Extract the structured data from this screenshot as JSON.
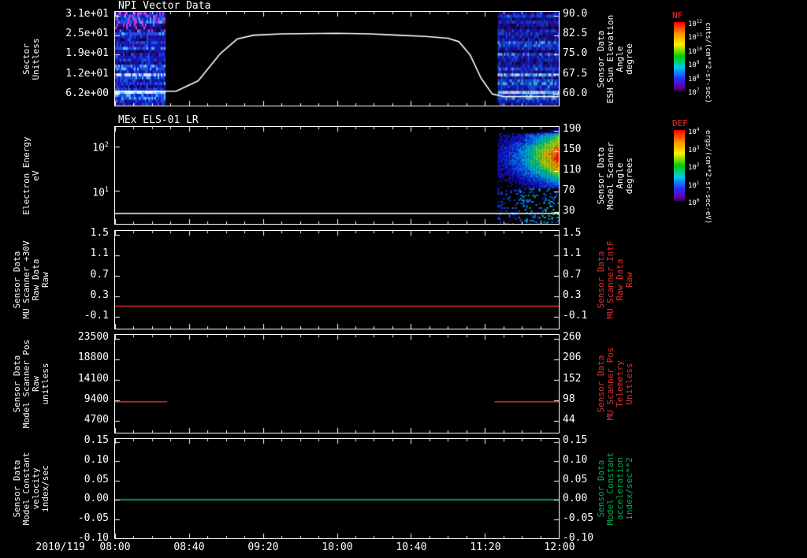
{
  "date_label": "2010/119",
  "colors": {
    "background": "#000000",
    "axis": "#ffffff",
    "red_series": "#e03030",
    "green_series": "#00b050"
  },
  "xaxis": {
    "ticks": [
      "08:00",
      "08:40",
      "09:20",
      "10:00",
      "10:40",
      "11:20",
      "12:00"
    ],
    "start_hour": 8,
    "end_hour": 12
  },
  "chart_data": [
    {
      "type": "heatmap",
      "name": "npi-vector-data",
      "title": "NPI Vector Data",
      "left_axis": {
        "label_lines": [
          "Sector",
          "Unitless"
        ],
        "ticks": [
          "3.1e+01",
          "2.5e+01",
          "1.9e+01",
          "1.2e+01",
          "6.2e+00"
        ]
      },
      "right_axis": {
        "label_lines": [
          "Sensor Data",
          "ESH Sun Elevation",
          "Angle",
          "degree"
        ],
        "label_color": "#ffffff",
        "ticks": [
          "90.0",
          "82.5",
          "75.0",
          "67.5",
          "60.0"
        ],
        "tick_values": [
          90.0,
          82.5,
          75.0,
          67.5,
          60.0
        ]
      },
      "heatmap_regions": [
        {
          "t0": 8.0,
          "t1": 8.45
        },
        {
          "t0": 11.45,
          "t1": 12.0
        }
      ],
      "line_series": {
        "name": "ESH Sun Elevation Angle",
        "color": "#ffffff",
        "axis": "right",
        "points": [
          [
            8.0,
            61
          ],
          [
            8.55,
            61
          ],
          [
            8.75,
            65
          ],
          [
            8.95,
            75.5
          ],
          [
            9.1,
            81
          ],
          [
            9.25,
            82.5
          ],
          [
            9.5,
            83
          ],
          [
            10.0,
            83.2
          ],
          [
            10.3,
            83
          ],
          [
            10.55,
            82.5
          ],
          [
            10.8,
            82
          ],
          [
            11.0,
            81.3
          ],
          [
            11.1,
            80
          ],
          [
            11.2,
            75
          ],
          [
            11.3,
            66
          ],
          [
            11.4,
            60
          ],
          [
            11.5,
            59
          ],
          [
            12.0,
            59
          ]
        ]
      },
      "colorbar": {
        "label": "NF",
        "ticks": [
          "10^12",
          "10^11",
          "10^10",
          "10^9",
          "10^8",
          "10^7"
        ],
        "units": "cnts/(cm**2-sr-sec)"
      }
    },
    {
      "type": "heatmap",
      "name": "mex-els-01-lr",
      "title": "MEx ELS-01 LR",
      "left_axis": {
        "label_lines": [
          "Electron Energy",
          "eV"
        ],
        "ticks": [
          "10^2",
          "10^1"
        ],
        "tick_fracs": [
          0.2,
          0.655
        ],
        "scale": "log"
      },
      "right_axis": {
        "label_lines": [
          "Sensor Data",
          "Model Scanner",
          "Angle",
          "degrees"
        ],
        "label_color": "#ffffff",
        "ticks": [
          "190",
          "150",
          "110",
          "70",
          "30"
        ]
      },
      "heatmap_regions": [
        {
          "t0": 11.45,
          "t1": 12.0
        }
      ],
      "flat_line": {
        "color": "#ffffff",
        "energy_ev": 3
      },
      "colorbar": {
        "label": "DEF",
        "ticks": [
          "10^4",
          "10^3",
          "10^2",
          "10^1",
          "10^0"
        ],
        "units": "ergs/(cm**2-sr-sec-eV)"
      }
    },
    {
      "type": "line",
      "name": "mu-scanner-30v-raw",
      "left_axis": {
        "label_lines": [
          "Sensor Data",
          "MU Scanner +30V",
          "Raw Data",
          "Raw"
        ],
        "ticks": [
          "1.5",
          "1.1",
          "0.7",
          "0.3",
          "-0.1"
        ],
        "tick_values": [
          1.5,
          1.1,
          0.7,
          0.3,
          -0.1
        ]
      },
      "right_axis": {
        "label_lines": [
          "Sensor Data",
          "MU Scanner IntF",
          "Raw Data",
          "Raw"
        ],
        "label_color": "#e03030",
        "ticks": [
          "1.5",
          "1.1",
          "0.7",
          "0.3",
          "-0.1"
        ]
      },
      "series": [
        {
          "name": "MU Scanner +30V Raw",
          "color": "#e03030",
          "segments": [
            [
              [
                8.0,
                0.1
              ],
              [
                12.0,
                0.1
              ]
            ]
          ]
        }
      ]
    },
    {
      "type": "line",
      "name": "model-scanner-pos-raw",
      "left_axis": {
        "label_lines": [
          "Sensor Data",
          "Model Scanner Pos",
          "Raw",
          "unitless"
        ],
        "ticks": [
          "23500",
          "18800",
          "14100",
          "9400",
          "4700"
        ],
        "tick_values": [
          23500,
          18800,
          14100,
          9400,
          4700
        ]
      },
      "right_axis": {
        "label_lines": [
          "Sensor Data",
          "MU Scanner Pos",
          "Telemetry",
          "Unitless"
        ],
        "label_color": "#e03030",
        "ticks": [
          "260",
          "206",
          "152",
          "98",
          "44"
        ]
      },
      "series": [
        {
          "name": "Model Scanner Pos Raw",
          "color": "#e03030",
          "segments": [
            [
              [
                8.0,
                9000
              ],
              [
                8.47,
                9000
              ]
            ],
            [
              [
                11.42,
                9000
              ],
              [
                12.0,
                9000
              ]
            ]
          ]
        }
      ]
    },
    {
      "type": "line",
      "name": "model-constant-velocity",
      "left_axis": {
        "label_lines": [
          "Sensor Data",
          "Model Constant",
          "velocity",
          "index/sec"
        ],
        "ticks": [
          "0.15",
          "0.10",
          "0.05",
          "0.00",
          "-0.05",
          "-0.10"
        ],
        "tick_values": [
          0.15,
          0.1,
          0.05,
          0.0,
          -0.05,
          -0.1
        ]
      },
      "right_axis": {
        "label_lines": [
          "Sensor Data",
          "Model Constant",
          "acceleration",
          "index/sec**2"
        ],
        "label_color": "#00b050",
        "ticks": [
          "0.15",
          "0.10",
          "0.05",
          "0.00",
          "-0.05",
          "-0.10"
        ]
      },
      "series": [
        {
          "name": "Model Constant velocity",
          "color": "#00b050",
          "segments": [
            [
              [
                8.0,
                0.0
              ],
              [
                12.0,
                0.0
              ]
            ]
          ]
        }
      ]
    }
  ]
}
